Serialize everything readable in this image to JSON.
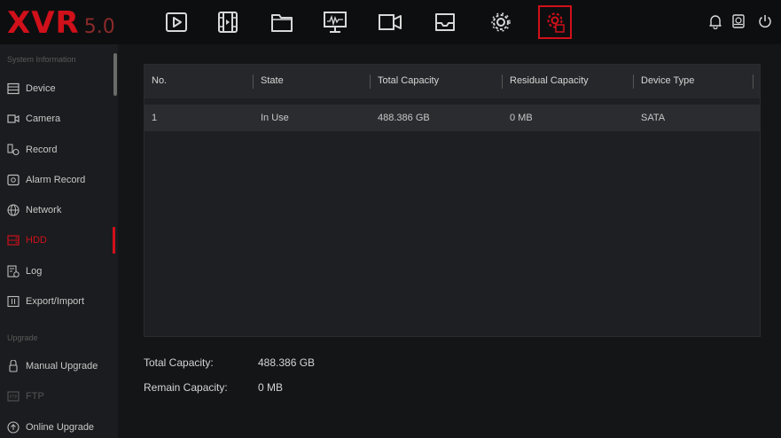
{
  "logo": {
    "brand": "XVR",
    "version": "5.0"
  },
  "topnav": [
    {
      "icon": "playback-icon",
      "active": false
    },
    {
      "icon": "video-clip-icon",
      "active": false
    },
    {
      "icon": "folder-icon",
      "active": false
    },
    {
      "icon": "monitor-icon",
      "active": false
    },
    {
      "icon": "camera-icon",
      "active": false
    },
    {
      "icon": "inbox-icon",
      "active": false
    },
    {
      "icon": "settings-gear-icon",
      "active": false
    },
    {
      "icon": "system-settings-icon",
      "active": true
    }
  ],
  "right_icons": [
    "bell-icon",
    "disk-icon",
    "power-icon"
  ],
  "sidebar": {
    "section_system": "System Information",
    "section_upgrade": "Upgrade",
    "items": [
      {
        "label": "Device",
        "icon": "device-icon",
        "active": false
      },
      {
        "label": "Camera",
        "icon": "camera-icon",
        "active": false
      },
      {
        "label": "Record",
        "icon": "record-icon",
        "active": false
      },
      {
        "label": "Alarm Record",
        "icon": "alarm-record-icon",
        "active": false
      },
      {
        "label": "Network",
        "icon": "network-icon",
        "active": false
      },
      {
        "label": "HDD",
        "icon": "hdd-icon",
        "active": true
      },
      {
        "label": "Log",
        "icon": "log-icon",
        "active": false
      },
      {
        "label": "Export/Import",
        "icon": "export-import-icon",
        "active": false
      }
    ],
    "upgrade_items": [
      {
        "label": "Manual Upgrade",
        "icon": "manual-upgrade-icon",
        "dim": false
      },
      {
        "label": "FTP",
        "icon": "ftp-icon",
        "dim": true
      },
      {
        "label": "Online Upgrade",
        "icon": "online-upgrade-icon",
        "dim": false
      }
    ]
  },
  "table": {
    "headers": [
      "No.",
      "State",
      "Total Capacity",
      "Residual Capacity",
      "Device Type"
    ],
    "rows": [
      [
        "1",
        "In Use",
        "488.386 GB",
        "0 MB",
        "SATA"
      ]
    ]
  },
  "summary": {
    "total_label": "Total Capacity:",
    "total_value": "488.386 GB",
    "remain_label": "Remain Capacity:",
    "remain_value": "0 MB"
  },
  "colors": {
    "accent": "#d0101a",
    "background": "#111214",
    "sidebar": "#1b1c1f"
  }
}
